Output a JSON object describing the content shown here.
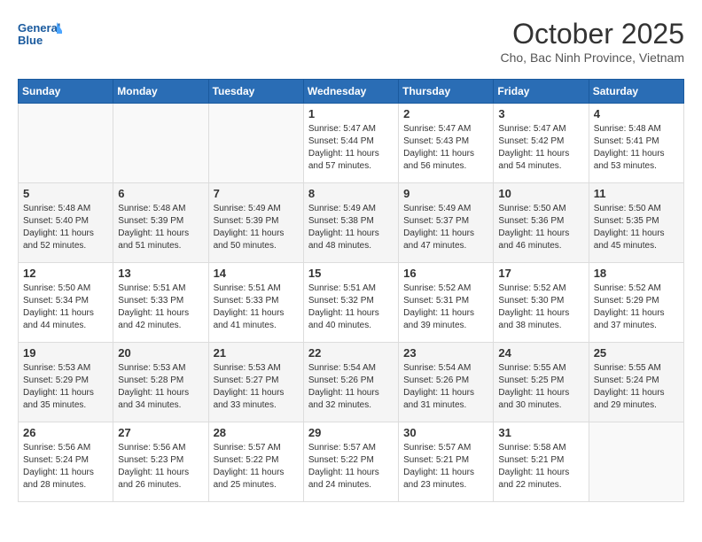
{
  "header": {
    "logo_line1": "General",
    "logo_line2": "Blue",
    "month_title": "October 2025",
    "subtitle": "Cho, Bac Ninh Province, Vietnam"
  },
  "days_of_week": [
    "Sunday",
    "Monday",
    "Tuesday",
    "Wednesday",
    "Thursday",
    "Friday",
    "Saturday"
  ],
  "weeks": [
    [
      {
        "day": "",
        "info": ""
      },
      {
        "day": "",
        "info": ""
      },
      {
        "day": "",
        "info": ""
      },
      {
        "day": "1",
        "info": "Sunrise: 5:47 AM\nSunset: 5:44 PM\nDaylight: 11 hours\nand 57 minutes."
      },
      {
        "day": "2",
        "info": "Sunrise: 5:47 AM\nSunset: 5:43 PM\nDaylight: 11 hours\nand 56 minutes."
      },
      {
        "day": "3",
        "info": "Sunrise: 5:47 AM\nSunset: 5:42 PM\nDaylight: 11 hours\nand 54 minutes."
      },
      {
        "day": "4",
        "info": "Sunrise: 5:48 AM\nSunset: 5:41 PM\nDaylight: 11 hours\nand 53 minutes."
      }
    ],
    [
      {
        "day": "5",
        "info": "Sunrise: 5:48 AM\nSunset: 5:40 PM\nDaylight: 11 hours\nand 52 minutes."
      },
      {
        "day": "6",
        "info": "Sunrise: 5:48 AM\nSunset: 5:39 PM\nDaylight: 11 hours\nand 51 minutes."
      },
      {
        "day": "7",
        "info": "Sunrise: 5:49 AM\nSunset: 5:39 PM\nDaylight: 11 hours\nand 50 minutes."
      },
      {
        "day": "8",
        "info": "Sunrise: 5:49 AM\nSunset: 5:38 PM\nDaylight: 11 hours\nand 48 minutes."
      },
      {
        "day": "9",
        "info": "Sunrise: 5:49 AM\nSunset: 5:37 PM\nDaylight: 11 hours\nand 47 minutes."
      },
      {
        "day": "10",
        "info": "Sunrise: 5:50 AM\nSunset: 5:36 PM\nDaylight: 11 hours\nand 46 minutes."
      },
      {
        "day": "11",
        "info": "Sunrise: 5:50 AM\nSunset: 5:35 PM\nDaylight: 11 hours\nand 45 minutes."
      }
    ],
    [
      {
        "day": "12",
        "info": "Sunrise: 5:50 AM\nSunset: 5:34 PM\nDaylight: 11 hours\nand 44 minutes."
      },
      {
        "day": "13",
        "info": "Sunrise: 5:51 AM\nSunset: 5:33 PM\nDaylight: 11 hours\nand 42 minutes."
      },
      {
        "day": "14",
        "info": "Sunrise: 5:51 AM\nSunset: 5:33 PM\nDaylight: 11 hours\nand 41 minutes."
      },
      {
        "day": "15",
        "info": "Sunrise: 5:51 AM\nSunset: 5:32 PM\nDaylight: 11 hours\nand 40 minutes."
      },
      {
        "day": "16",
        "info": "Sunrise: 5:52 AM\nSunset: 5:31 PM\nDaylight: 11 hours\nand 39 minutes."
      },
      {
        "day": "17",
        "info": "Sunrise: 5:52 AM\nSunset: 5:30 PM\nDaylight: 11 hours\nand 38 minutes."
      },
      {
        "day": "18",
        "info": "Sunrise: 5:52 AM\nSunset: 5:29 PM\nDaylight: 11 hours\nand 37 minutes."
      }
    ],
    [
      {
        "day": "19",
        "info": "Sunrise: 5:53 AM\nSunset: 5:29 PM\nDaylight: 11 hours\nand 35 minutes."
      },
      {
        "day": "20",
        "info": "Sunrise: 5:53 AM\nSunset: 5:28 PM\nDaylight: 11 hours\nand 34 minutes."
      },
      {
        "day": "21",
        "info": "Sunrise: 5:53 AM\nSunset: 5:27 PM\nDaylight: 11 hours\nand 33 minutes."
      },
      {
        "day": "22",
        "info": "Sunrise: 5:54 AM\nSunset: 5:26 PM\nDaylight: 11 hours\nand 32 minutes."
      },
      {
        "day": "23",
        "info": "Sunrise: 5:54 AM\nSunset: 5:26 PM\nDaylight: 11 hours\nand 31 minutes."
      },
      {
        "day": "24",
        "info": "Sunrise: 5:55 AM\nSunset: 5:25 PM\nDaylight: 11 hours\nand 30 minutes."
      },
      {
        "day": "25",
        "info": "Sunrise: 5:55 AM\nSunset: 5:24 PM\nDaylight: 11 hours\nand 29 minutes."
      }
    ],
    [
      {
        "day": "26",
        "info": "Sunrise: 5:56 AM\nSunset: 5:24 PM\nDaylight: 11 hours\nand 28 minutes."
      },
      {
        "day": "27",
        "info": "Sunrise: 5:56 AM\nSunset: 5:23 PM\nDaylight: 11 hours\nand 26 minutes."
      },
      {
        "day": "28",
        "info": "Sunrise: 5:57 AM\nSunset: 5:22 PM\nDaylight: 11 hours\nand 25 minutes."
      },
      {
        "day": "29",
        "info": "Sunrise: 5:57 AM\nSunset: 5:22 PM\nDaylight: 11 hours\nand 24 minutes."
      },
      {
        "day": "30",
        "info": "Sunrise: 5:57 AM\nSunset: 5:21 PM\nDaylight: 11 hours\nand 23 minutes."
      },
      {
        "day": "31",
        "info": "Sunrise: 5:58 AM\nSunset: 5:21 PM\nDaylight: 11 hours\nand 22 minutes."
      },
      {
        "day": "",
        "info": ""
      }
    ]
  ]
}
